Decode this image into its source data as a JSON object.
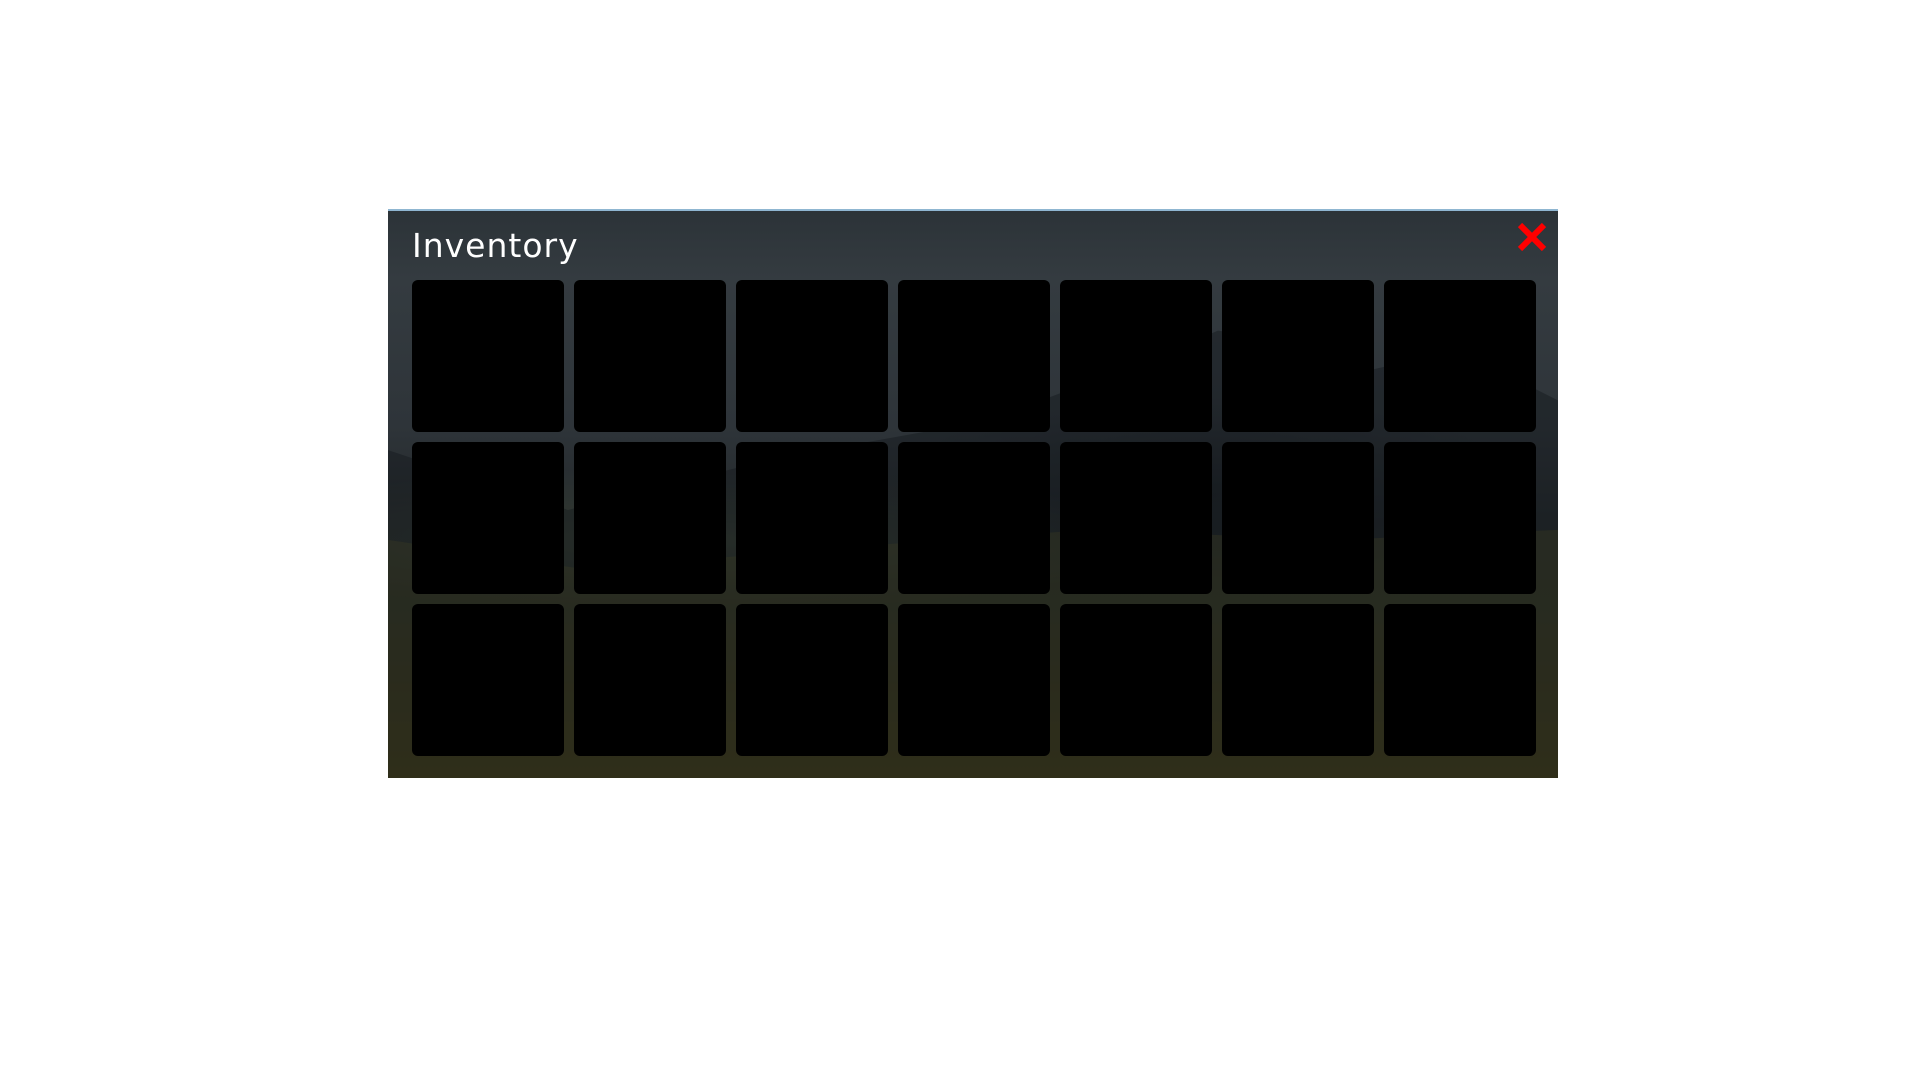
{
  "inventory": {
    "title": "Inventory",
    "close_icon": "close-x-icon",
    "close_color": "#ff0000",
    "rows": 3,
    "columns": 7,
    "slots": [
      {
        "item": null
      },
      {
        "item": null
      },
      {
        "item": null
      },
      {
        "item": null
      },
      {
        "item": null
      },
      {
        "item": null
      },
      {
        "item": null
      },
      {
        "item": null
      },
      {
        "item": null
      },
      {
        "item": null
      },
      {
        "item": null
      },
      {
        "item": null
      },
      {
        "item": null
      },
      {
        "item": null
      },
      {
        "item": null
      },
      {
        "item": null
      },
      {
        "item": null
      },
      {
        "item": null
      },
      {
        "item": null
      },
      {
        "item": null
      },
      {
        "item": null
      }
    ]
  }
}
